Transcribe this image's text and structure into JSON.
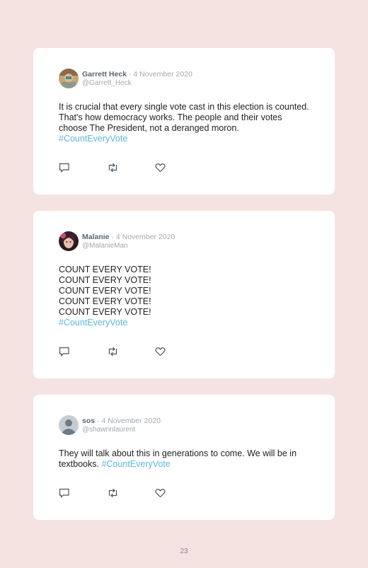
{
  "tweets": [
    {
      "name": "Garrett Heck",
      "separator": "·",
      "date": "4 November 2020",
      "handle": "@Garrett_Heck",
      "text": "It is crucial that every single vote cast in this election is counted. That's how democracy works. The people and their votes choose The President, not a deranged moron.",
      "hashtag": "#CountEveryVote",
      "avatar": "photo-avatar"
    },
    {
      "name": "Malanie",
      "separator": "·",
      "date": "4 November 2020",
      "handle": "@MalanieMan",
      "text": "COUNT EVERY VOTE!\nCOUNT EVERY VOTE!\nCOUNT EVERY VOTE!\nCOUNT EVERY VOTE!\nCOUNT EVERY VOTE!",
      "hashtag": "#CountEveryVote",
      "avatar": "photo-avatar"
    },
    {
      "name": "sos",
      "separator": "·",
      "date": "4 November 2020",
      "handle": "@shawnnlaurent",
      "text": "They will talk about this in generations to come. We will be in textbooks. ",
      "hashtag": "#CountEveryVote",
      "avatar": "default-avatar"
    }
  ],
  "icons": [
    "reply-icon",
    "retweet-icon",
    "like-icon"
  ],
  "colors": {
    "background": "#f5e3e2",
    "card": "#ffffff",
    "hashtag": "#5cb8e0",
    "name": "#5b6670",
    "muted": "#a2aab0"
  },
  "page_number": "23"
}
